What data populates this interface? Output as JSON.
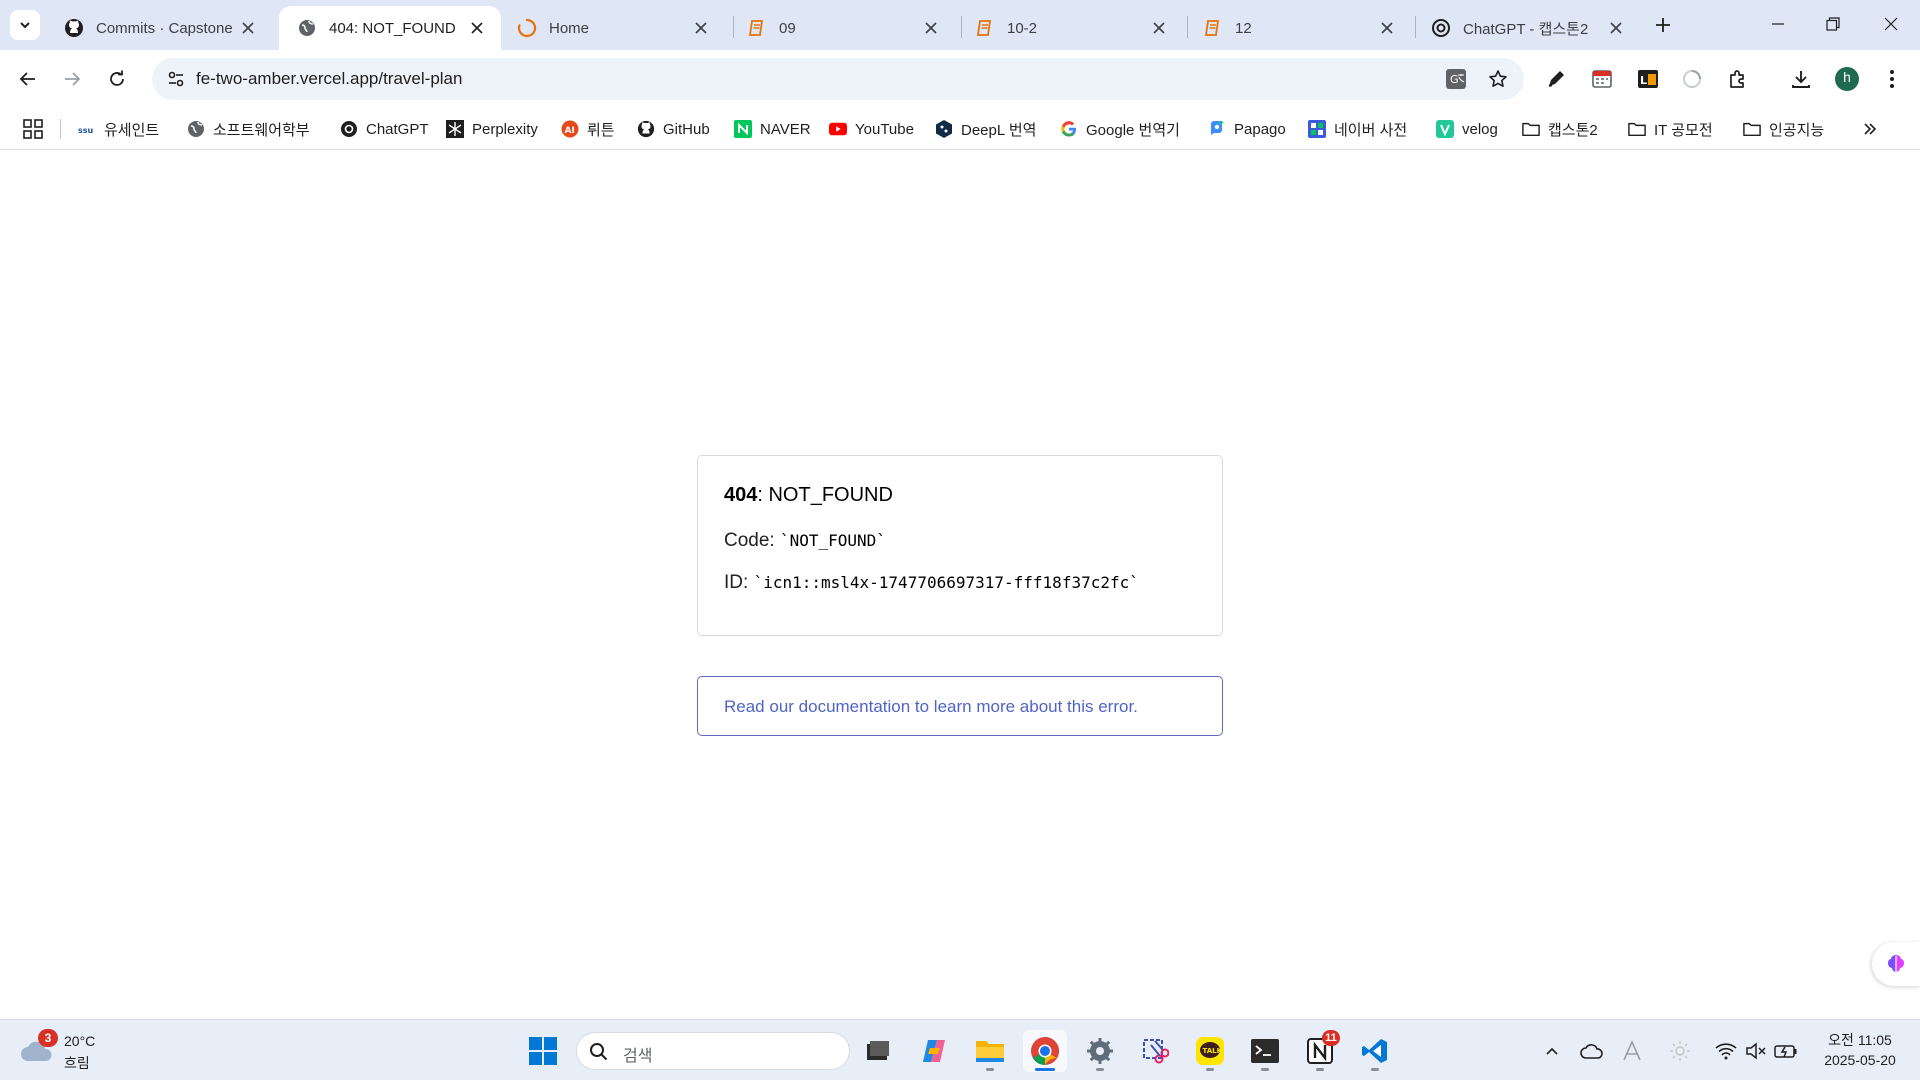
{
  "browser": {
    "tabs": [
      {
        "title": "Commits · Capstone",
        "icon": "github-icon",
        "active": false
      },
      {
        "title": "404: NOT_FOUND",
        "icon": "globe-icon",
        "active": true
      },
      {
        "title": "Home",
        "icon": "loading-spinner-icon",
        "active": false
      },
      {
        "title": "09",
        "icon": "book-icon",
        "active": false
      },
      {
        "title": "10-2",
        "icon": "book-icon",
        "active": false
      },
      {
        "title": "12",
        "icon": "book-icon",
        "active": false
      },
      {
        "title": "ChatGPT - 캡스톤2",
        "icon": "chatgpt-icon",
        "active": false
      }
    ],
    "address_bar": {
      "url": "fe-two-amber.vercel.app/travel-plan"
    },
    "bookmarks": [
      {
        "label": "유세인트",
        "icon": "usaint-icon"
      },
      {
        "label": "소프트웨어학부",
        "icon": "globe-icon"
      },
      {
        "label": "ChatGPT",
        "icon": "chatgpt-icon"
      },
      {
        "label": "Perplexity",
        "icon": "perplexity-icon"
      },
      {
        "label": "뤼튼",
        "icon": "wrtn-icon"
      },
      {
        "label": "GitHub",
        "icon": "github-icon"
      },
      {
        "label": "NAVER",
        "icon": "naver-icon"
      },
      {
        "label": "YouTube",
        "icon": "youtube-icon"
      },
      {
        "label": "DeepL 번역",
        "icon": "deepl-icon"
      },
      {
        "label": "Google 번역기",
        "icon": "google-icon"
      },
      {
        "label": "Papago",
        "icon": "papago-icon"
      },
      {
        "label": "네이버 사전",
        "icon": "naver-dictionary-icon"
      },
      {
        "label": "velog",
        "icon": "velog-icon"
      },
      {
        "label": "캡스톤2",
        "icon": "folder-icon"
      },
      {
        "label": "IT 공모전",
        "icon": "folder-icon"
      },
      {
        "label": "인공지능",
        "icon": "folder-icon"
      }
    ],
    "profile_initial": "h"
  },
  "page": {
    "error": {
      "code_number": "404",
      "code_text": ": NOT_FOUND",
      "code_label": "Code: ",
      "code_value": "`NOT_FOUND`",
      "id_label": "ID: ",
      "id_value": "`icn1::msl4x-1747706697317-fff18f37c2fc`"
    },
    "doc_link": "Read our documentation to learn more about this error."
  },
  "taskbar": {
    "weather": {
      "badge": "3",
      "temperature": "20°C",
      "condition": "흐림"
    },
    "search_placeholder": "검색",
    "apps": [
      {
        "name": "task-view",
        "running": false
      },
      {
        "name": "copilot",
        "running": false
      },
      {
        "name": "file-explorer",
        "running": true
      },
      {
        "name": "chrome",
        "running": true,
        "active": true
      },
      {
        "name": "settings",
        "running": true
      },
      {
        "name": "snipping-tool",
        "running": false
      },
      {
        "name": "kakaotalk",
        "running": true
      },
      {
        "name": "terminal",
        "running": true
      },
      {
        "name": "notion",
        "running": true,
        "badge": "11"
      },
      {
        "name": "vscode",
        "running": true
      }
    ],
    "clock": {
      "time": "오전 11:05",
      "date": "2025-05-20"
    }
  },
  "colors": {
    "link": "#5064c8",
    "tab_strip": "#dfe6f5",
    "taskbar": "#e8eef7"
  }
}
